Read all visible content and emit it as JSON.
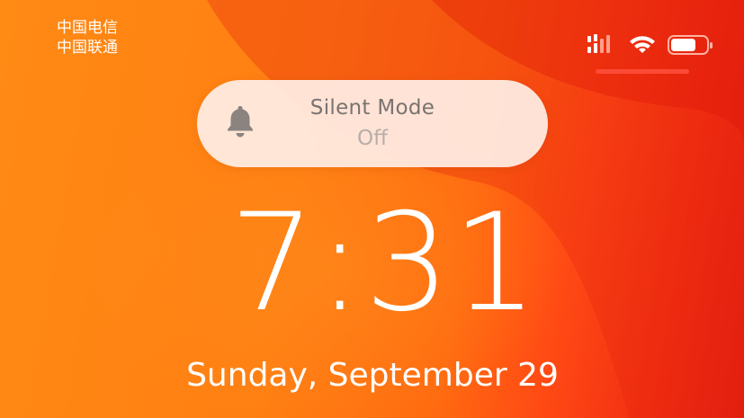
{
  "carrier": {
    "line1": "中国电信",
    "line2": "中国联通"
  },
  "status_bar": {
    "signal_icon": "cellular-signal-icon",
    "wifi_icon": "wifi-icon",
    "battery_icon": "battery-icon"
  },
  "notification": {
    "icon": "bell-icon",
    "title": "Silent Mode",
    "status": "Off"
  },
  "lock_screen": {
    "time": "7:31",
    "date": "Sunday, September 29"
  },
  "colors": {
    "wallpaper_left": "#ff8a14",
    "wallpaper_right": "#e01a10",
    "banner_bg": "#ffece2",
    "banner_title": "#7a7370",
    "banner_sub": "#b7aea9",
    "text": "#ffffff"
  }
}
